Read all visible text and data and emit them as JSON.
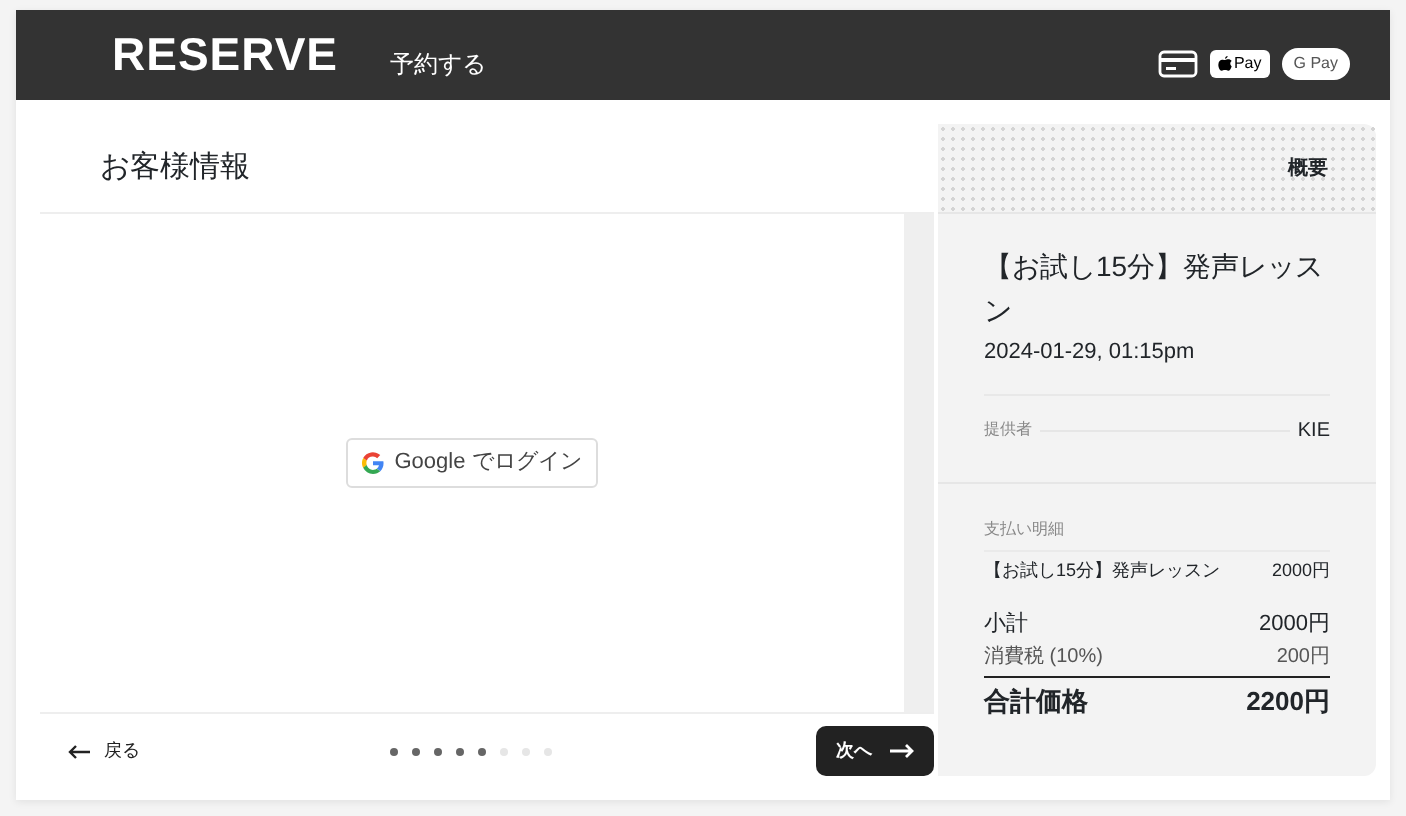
{
  "header": {
    "logo": "RESERVE",
    "nav": "予約する",
    "payments": [
      {
        "kind": "card"
      },
      {
        "kind": "apple",
        "label": "Pay"
      },
      {
        "kind": "google",
        "label": "G Pay"
      }
    ]
  },
  "form": {
    "title": "お客様情報",
    "login_button": "Google でログイン"
  },
  "footer": {
    "back": "戻る",
    "next": "次へ",
    "steps": [
      {
        "done": true
      },
      {
        "done": true
      },
      {
        "done": true
      },
      {
        "done": true
      },
      {
        "done": true
      },
      {
        "done": false
      },
      {
        "done": false
      },
      {
        "done": false
      }
    ]
  },
  "summary": {
    "heading": "概要",
    "service": "【お試し15分】発声レッスン",
    "datetime": "2024-01-29, 01:15pm",
    "provider_label": "提供者",
    "provider": "KIE",
    "payment_title": "支払い明細",
    "lines": [
      {
        "kind": "item",
        "label": "【お試し15分】発声レッスン",
        "amount": "2000円"
      },
      {
        "kind": "subtotal",
        "label": "小計",
        "amount": "2000円"
      },
      {
        "kind": "tax",
        "label": "消費税 (10%)",
        "amount": "200円"
      },
      {
        "kind": "total",
        "label": "合計価格",
        "amount": "2200円"
      }
    ]
  }
}
